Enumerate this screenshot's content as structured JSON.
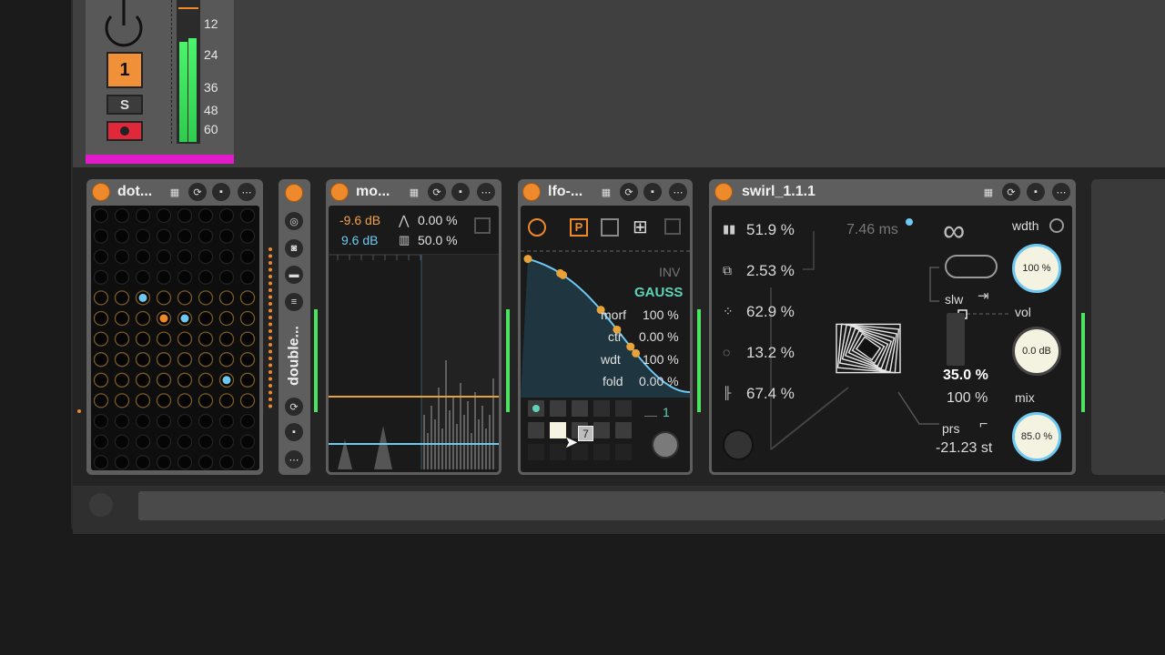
{
  "mixer": {
    "track_number": "1",
    "solo_label": "S",
    "db_scale": [
      "12",
      "24",
      "36",
      "48",
      "60"
    ]
  },
  "devices": {
    "dots": {
      "title": "dot..."
    },
    "double": {
      "title": "double..."
    },
    "mod": {
      "title": "mo...",
      "gain_neg": "-9.6 dB",
      "gain_pos": "9.6 dB",
      "pct_top": "0.00 %",
      "pct_bottom": "50.0 %"
    },
    "lfo": {
      "title": "lfo-...",
      "inv_label": "INV",
      "gauss_label": "GAUSS",
      "params": [
        {
          "label": "morf",
          "value": "100 %"
        },
        {
          "label": "ctr",
          "value": "0.00 %"
        },
        {
          "label": "wdt",
          "value": "100 %"
        },
        {
          "label": "fold",
          "value": "0.00 %"
        }
      ],
      "step_value": "1",
      "selected_pad": "7"
    },
    "swirl": {
      "title": "swirl_1.1.1",
      "rows": [
        "51.9 %",
        "2.53 %",
        "62.9 %",
        "13.2 %",
        "67.4 %"
      ],
      "time_value": "7.46 ms",
      "slw_label": "slw",
      "slw_value": "35.0 %",
      "slw_sub": "100 %",
      "prs_label": "prs",
      "prs_value": "-21.23 st",
      "wdth_label": "wdth",
      "wdth_value": "100 %",
      "vol_label": "vol",
      "vol_value": "0.0 dB",
      "mix_label": "mix",
      "mix_value": "85.0 %"
    }
  },
  "colors": {
    "accent_orange": "#ef8a2c",
    "accent_blue": "#6ec8f0",
    "accent_teal": "#5fd3b7",
    "meter_green": "#4ce35e",
    "track_pink": "#e21bc8",
    "arm_red": "#e0283a"
  }
}
